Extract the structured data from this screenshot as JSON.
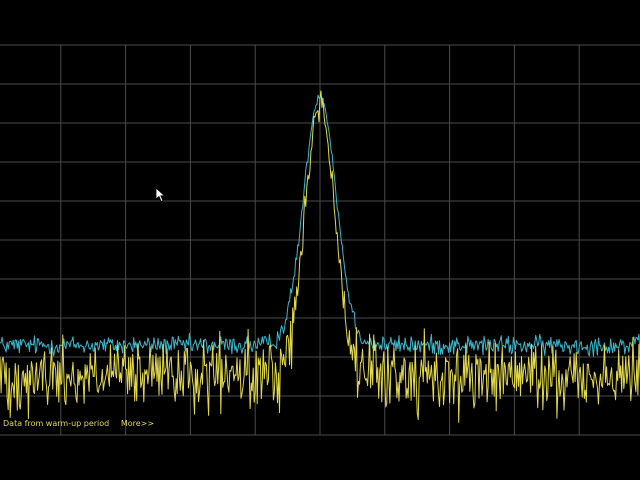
{
  "status": {
    "message": "Data from warm-up period",
    "more_link": "More>>"
  },
  "colors": {
    "background": "#000000",
    "grid": "#4a4a4a",
    "trace_max_hold": "#38b7cc",
    "trace_live": "#e3d84a"
  },
  "cursor": {
    "icon": "mouse-pointer-icon"
  },
  "chart_data": {
    "type": "line",
    "title": "",
    "xlabel": "",
    "ylabel": "",
    "xlim": [
      0,
      100
    ],
    "ylim": [
      0,
      10
    ],
    "grid": true,
    "grid_divisions": {
      "x": 10,
      "y": 10
    },
    "peak_x": 50,
    "series": [
      {
        "color": "#38b7cc",
        "noise_floor": 2.3,
        "peak": 8.7,
        "peak_width": 2.5,
        "noise": 0.15
      },
      {
        "color": "#e3d84a",
        "noise_floor": 1.5,
        "peak": 8.5,
        "peak_width": 2.3,
        "noise": 0.55
      }
    ]
  }
}
